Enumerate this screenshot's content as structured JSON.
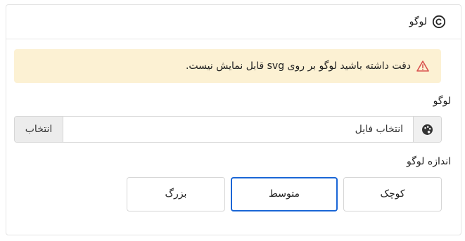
{
  "header": {
    "title": "لوگو",
    "icon": "copyright-icon"
  },
  "alert": {
    "text": "دقت داشته باشید لوگو بر روی svg قابل نمایش نیست.",
    "icon": "warning-triangle-icon",
    "color": "#fcf1d3",
    "icon_color": "#d9534f"
  },
  "logo_field": {
    "label": "لوگو",
    "placeholder": "انتخاب فایل",
    "button_label": "انتخاب",
    "icon": "palette-icon"
  },
  "size_field": {
    "label": "اندازه لوگو",
    "options": [
      {
        "label": "کوچک",
        "selected": false
      },
      {
        "label": "متوسط",
        "selected": true
      },
      {
        "label": "بزرگ",
        "selected": false
      }
    ],
    "accent": "#1a66d6"
  }
}
